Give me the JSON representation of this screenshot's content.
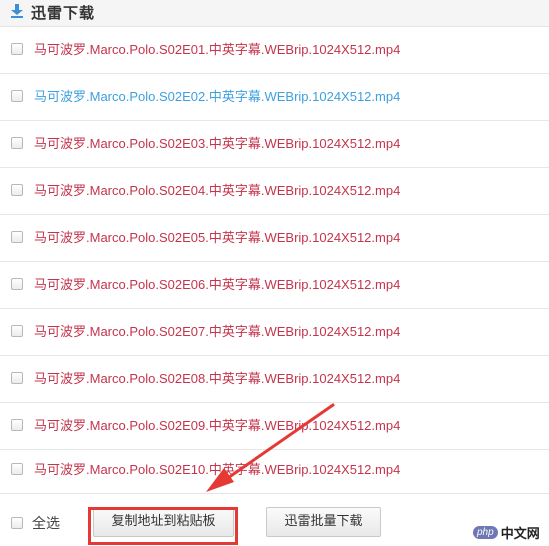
{
  "header": {
    "title": "迅雷下载",
    "icon": "download-arrow-icon"
  },
  "files": [
    {
      "name": "马可波罗.Marco.Polo.S02E01.中英字幕.WEBrip.1024X512.mp4",
      "visited": false
    },
    {
      "name": "马可波罗.Marco.Polo.S02E02.中英字幕.WEBrip.1024X512.mp4",
      "visited": true
    },
    {
      "name": "马可波罗.Marco.Polo.S02E03.中英字幕.WEBrip.1024X512.mp4",
      "visited": false
    },
    {
      "name": "马可波罗.Marco.Polo.S02E04.中英字幕.WEBrip.1024X512.mp4",
      "visited": false
    },
    {
      "name": "马可波罗.Marco.Polo.S02E05.中英字幕.WEBrip.1024X512.mp4",
      "visited": false
    },
    {
      "name": "马可波罗.Marco.Polo.S02E06.中英字幕.WEBrip.1024X512.mp4",
      "visited": false
    },
    {
      "name": "马可波罗.Marco.Polo.S02E07.中英字幕.WEBrip.1024X512.mp4",
      "visited": false
    },
    {
      "name": "马可波罗.Marco.Polo.S02E08.中英字幕.WEBrip.1024X512.mp4",
      "visited": false
    },
    {
      "name": "马可波罗.Marco.Polo.S02E09.中英字幕.WEBrip.1024X512.mp4",
      "visited": false
    },
    {
      "name": "马可波罗.Marco.Polo.S02E10.中英字幕.WEBrip.1024X512.mp4",
      "visited": false
    }
  ],
  "footer": {
    "select_all_label": "全选",
    "copy_button_label": "复制地址到粘贴板",
    "batch_download_label": "迅雷批量下载"
  },
  "watermark": {
    "badge": "php",
    "text": "中文网"
  },
  "colors": {
    "link": "#c4344c",
    "visited_link": "#3da0e0",
    "highlight": "#e53935"
  }
}
